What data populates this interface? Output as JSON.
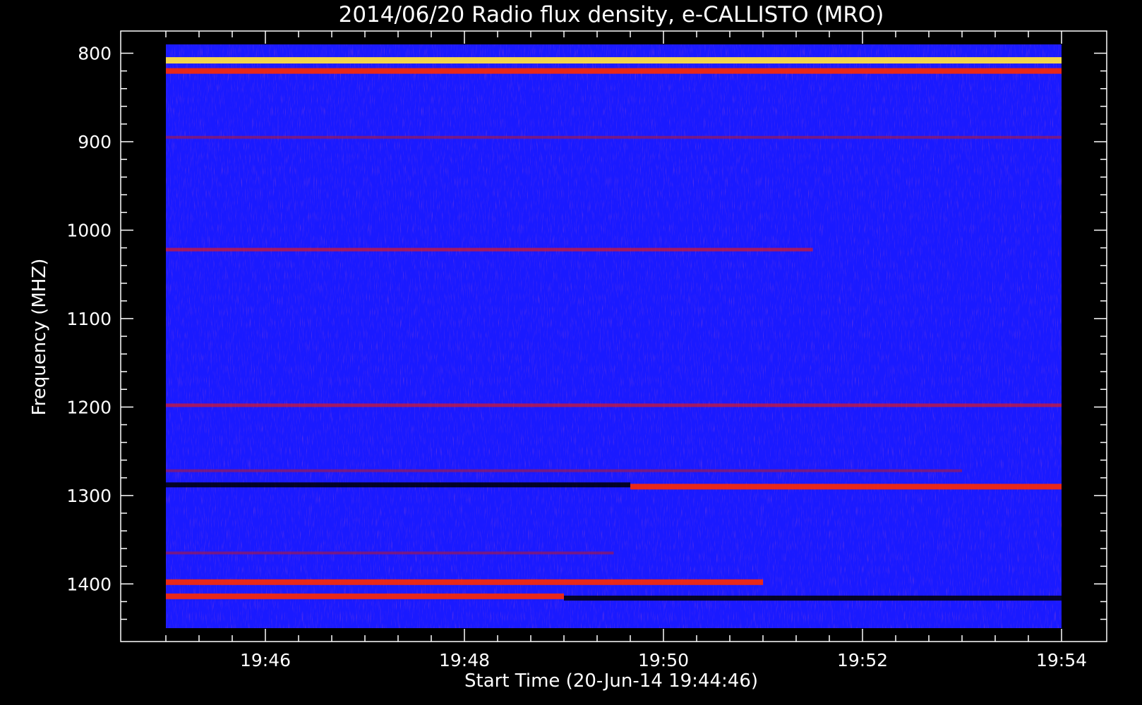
{
  "chart_data": {
    "type": "heatmap",
    "title": "2014/06/20  Radio flux density, e-CALLISTO (MRO)",
    "xlabel": "Start Time (20-Jun-14 19:44:46)",
    "ylabel": "Frequency (MHZ)",
    "x_range": [
      "19:45:00",
      "19:54:00"
    ],
    "x_ticks": [
      "19:46",
      "19:48",
      "19:50",
      "19:52",
      "19:54"
    ],
    "y_range": [
      790,
      1450
    ],
    "y_ticks": [
      800,
      900,
      1000,
      1100,
      1200,
      1300,
      1400
    ],
    "y_inverted": true,
    "colormap": {
      "low": "#000000",
      "background": "#1a1aff",
      "mid": "#ff2000",
      "high": "#ffff60"
    },
    "bands": [
      {
        "freq": 808,
        "start": "19:45:00",
        "end": "19:54:00",
        "intensity": "very high"
      },
      {
        "freq": 820,
        "start": "19:45:00",
        "end": "19:54:00",
        "intensity": "high"
      },
      {
        "freq": 895,
        "start": "19:45:00",
        "end": "19:54:00",
        "intensity": "low"
      },
      {
        "freq": 1022,
        "start": "19:45:00",
        "end": "19:51:30",
        "intensity": "medium"
      },
      {
        "freq": 1198,
        "start": "19:45:00",
        "end": "19:54:00",
        "intensity": "medium"
      },
      {
        "freq": 1272,
        "start": "19:45:00",
        "end": "19:53:00",
        "intensity": "low"
      },
      {
        "freq": 1288,
        "start": "19:45:00",
        "end": "19:49:40",
        "intensity": "dark"
      },
      {
        "freq": 1290,
        "start": "19:49:40",
        "end": "19:54:00",
        "intensity": "high"
      },
      {
        "freq": 1365,
        "start": "19:45:00",
        "end": "19:49:30",
        "intensity": "low"
      },
      {
        "freq": 1398,
        "start": "19:45:00",
        "end": "19:51:00",
        "intensity": "high"
      },
      {
        "freq": 1414,
        "start": "19:45:00",
        "end": "19:49:00",
        "intensity": "high"
      },
      {
        "freq": 1416,
        "start": "19:49:00",
        "end": "19:54:00",
        "intensity": "dark"
      }
    ]
  }
}
